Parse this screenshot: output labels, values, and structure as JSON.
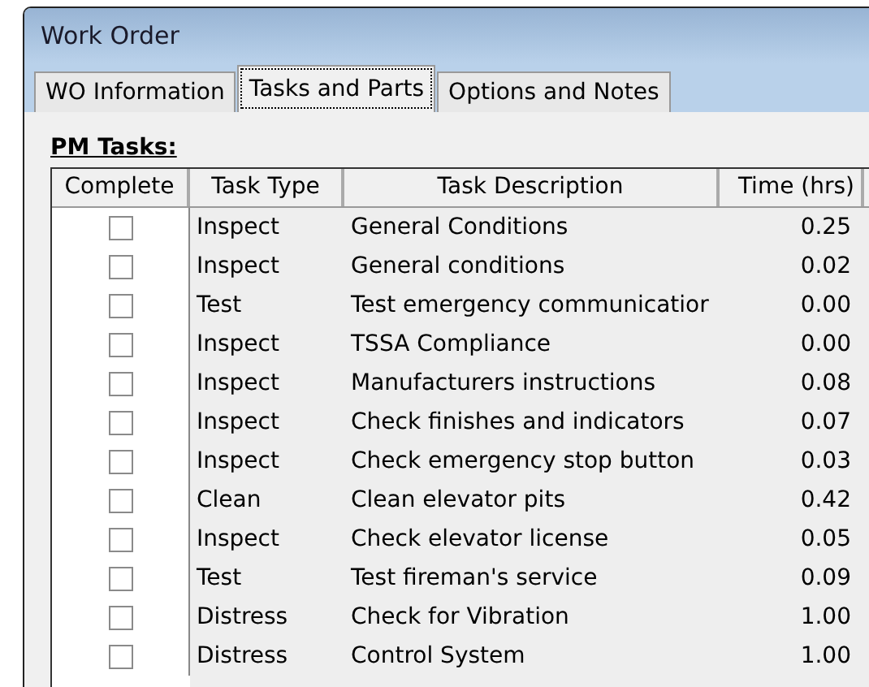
{
  "window": {
    "title": "Work Order"
  },
  "tabs": [
    {
      "label": "WO Information",
      "selected": false
    },
    {
      "label": "Tasks and Parts",
      "selected": true
    },
    {
      "label": "Options and Notes",
      "selected": false
    }
  ],
  "section_title": "PM Tasks:",
  "table": {
    "columns": [
      "Complete",
      "Task Type",
      "Task Description",
      "Time (hrs)"
    ],
    "rows": [
      {
        "complete": false,
        "type": "Inspect",
        "description": "General Conditions",
        "time": "0.25"
      },
      {
        "complete": false,
        "type": "Inspect",
        "description": "General conditions",
        "time": "0.02"
      },
      {
        "complete": false,
        "type": "Test",
        "description": "Test emergency communicatior",
        "time": "0.00"
      },
      {
        "complete": false,
        "type": "Inspect",
        "description": "TSSA Compliance",
        "time": "0.00"
      },
      {
        "complete": false,
        "type": "Inspect",
        "description": "Manufacturers instructions",
        "time": "0.08"
      },
      {
        "complete": false,
        "type": "Inspect",
        "description": "Check finishes and indicators",
        "time": "0.07"
      },
      {
        "complete": false,
        "type": "Inspect",
        "description": "Check emergency stop button",
        "time": "0.03"
      },
      {
        "complete": false,
        "type": "Clean",
        "description": "Clean elevator pits",
        "time": "0.42"
      },
      {
        "complete": false,
        "type": "Inspect",
        "description": "Check elevator license",
        "time": "0.05"
      },
      {
        "complete": false,
        "type": "Test",
        "description": "Test fireman's service",
        "time": "0.09"
      },
      {
        "complete": false,
        "type": "Distress",
        "description": "Check for Vibration",
        "time": "1.00"
      },
      {
        "complete": false,
        "type": "Distress",
        "description": "Control System",
        "time": "1.00"
      }
    ]
  }
}
